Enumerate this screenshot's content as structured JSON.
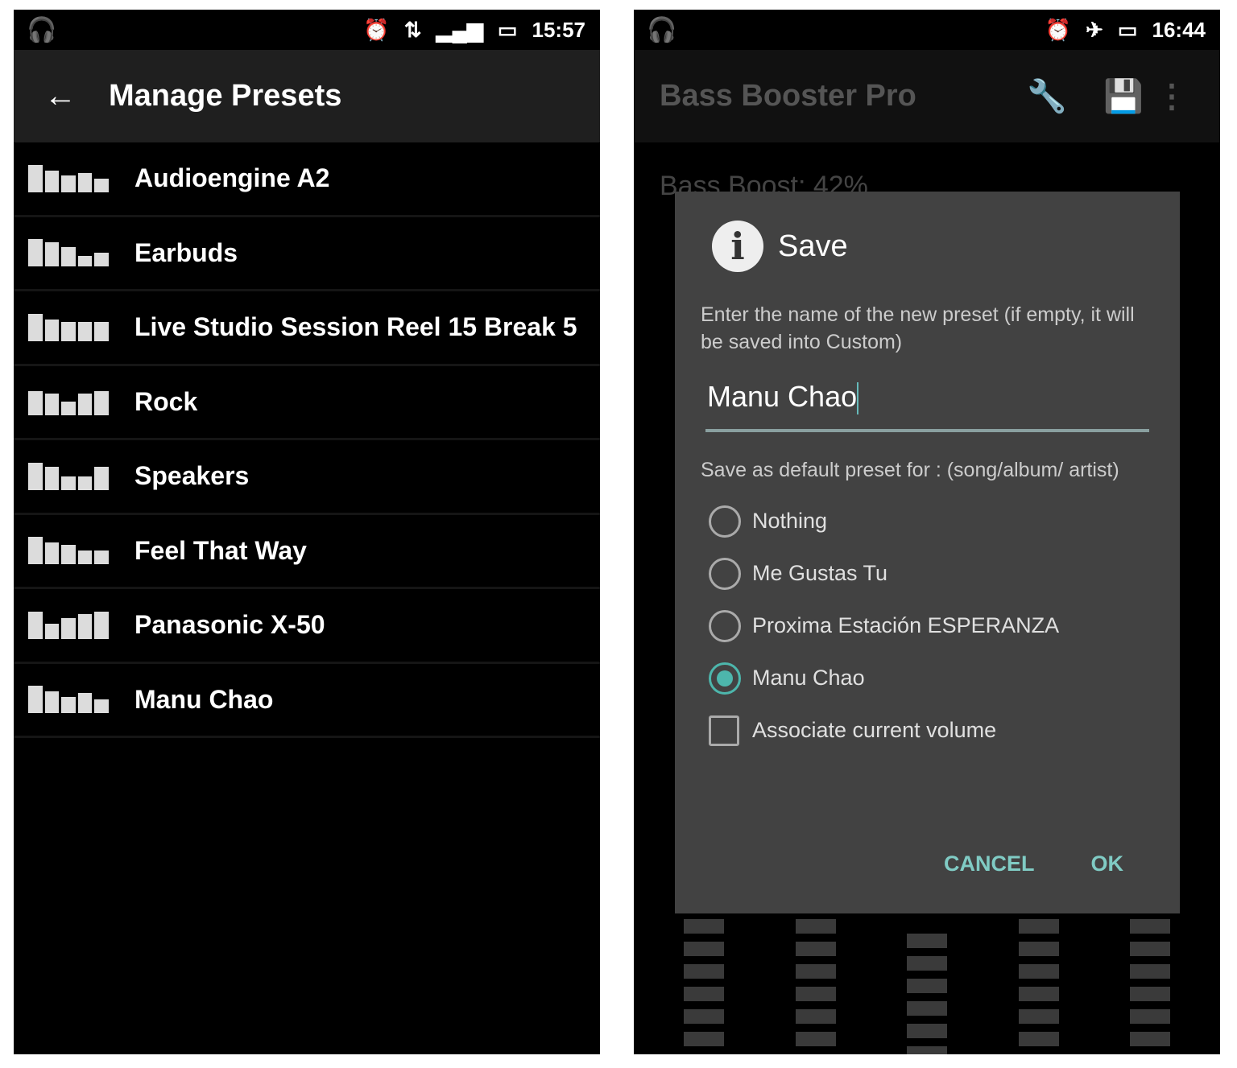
{
  "left": {
    "status": {
      "time": "15:57",
      "icons": [
        "headphones-icon",
        "alarm-icon",
        "data-icon",
        "signal-icon",
        "battery-icon"
      ]
    },
    "toolbar": {
      "title": "Manage Presets",
      "back_icon": "arrow-left-icon"
    },
    "presets": [
      {
        "name": "Audioengine A2",
        "eq_levels": [
          1,
          0.8,
          0.6,
          0.7,
          0.5
        ]
      },
      {
        "name": "Earbuds",
        "eq_levels": [
          1,
          0.9,
          0.7,
          0.4,
          0.5
        ]
      },
      {
        "name": "Live Studio Session Reel 15 Break 5",
        "eq_levels": [
          1,
          0.8,
          0.7,
          0.7,
          0.7
        ]
      },
      {
        "name": "Rock",
        "eq_levels": [
          0.9,
          0.8,
          0.5,
          0.8,
          0.9
        ]
      },
      {
        "name": "Speakers",
        "eq_levels": [
          1,
          0.85,
          0.5,
          0.5,
          0.85
        ]
      },
      {
        "name": "Feel That Way",
        "eq_levels": [
          1,
          0.8,
          0.7,
          0.5,
          0.5
        ]
      },
      {
        "name": "Panasonic X-50",
        "eq_levels": [
          1,
          0.55,
          0.75,
          0.9,
          1
        ]
      },
      {
        "name": "Manu Chao",
        "eq_levels": [
          1,
          0.8,
          0.6,
          0.75,
          0.5
        ]
      }
    ]
  },
  "right": {
    "status": {
      "time": "16:44",
      "icons": [
        "headphones-icon",
        "alarm-icon",
        "airplane-icon",
        "battery-icon"
      ]
    },
    "toolbar": {
      "title": "Bass Booster Pro",
      "icons": [
        "wrench-icon",
        "save-icon",
        "more-vert-icon"
      ]
    },
    "background": {
      "bass_boost": "Bass Boost: 42%"
    },
    "dialog": {
      "title": "Save",
      "message": "Enter the name of the new preset (if empty, it will be saved into Custom)",
      "input_value": "Manu Chao",
      "default_label": "Save as default preset for : (song/album/ artist)",
      "options": [
        {
          "label": "Nothing",
          "selected": false
        },
        {
          "label": "Me Gustas Tu",
          "selected": false
        },
        {
          "label": "Proxima Estación ESPERANZA",
          "selected": false
        },
        {
          "label": "Manu Chao",
          "selected": true
        }
      ],
      "associate_volume": {
        "label": "Associate current volume",
        "checked": false
      },
      "cancel": "CANCEL",
      "ok": "OK",
      "accent": "#80cbc4"
    }
  }
}
